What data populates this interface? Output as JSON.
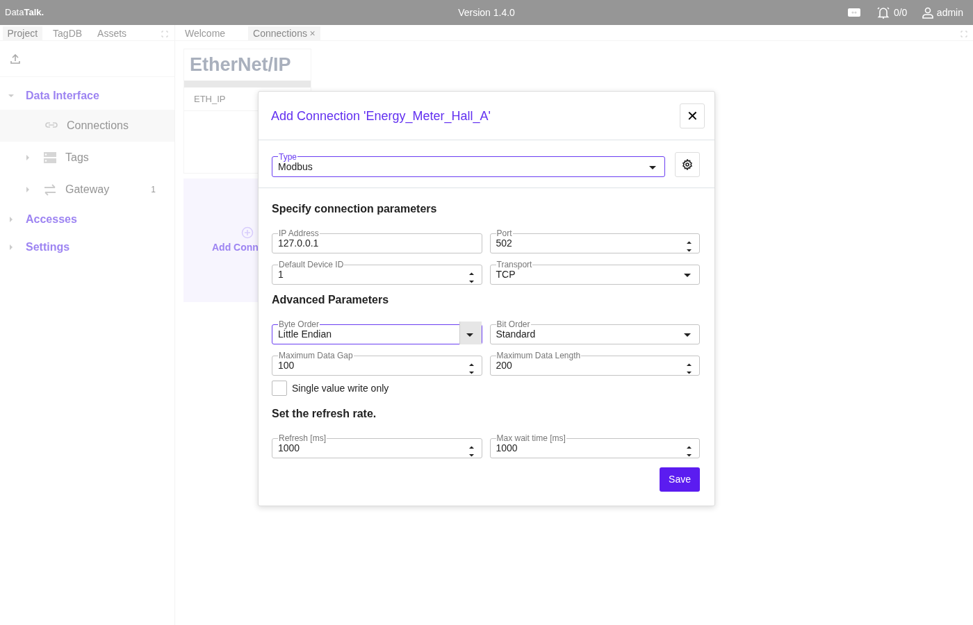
{
  "app": {
    "logo_light": "Data",
    "logo_bold": "Talk.",
    "version": "Version 1.4.0",
    "alarms": "0/0",
    "user": "admin"
  },
  "left_tabs": [
    {
      "label": "Project",
      "selected": true
    },
    {
      "label": "TagDB",
      "selected": false
    },
    {
      "label": "Assets",
      "selected": false
    }
  ],
  "tree": [
    {
      "label": "Data Interface",
      "expanded": true,
      "children": [
        {
          "label": "Connections",
          "selected": true,
          "expandable": false
        },
        {
          "label": "Tags",
          "selected": false,
          "expandable": true
        },
        {
          "label": "Gateway",
          "selected": false,
          "expandable": true,
          "count": "1"
        }
      ]
    },
    {
      "label": "Accesses",
      "expanded": false
    },
    {
      "label": "Settings",
      "expanded": false
    }
  ],
  "doc_tabs": [
    {
      "label": "Welcome",
      "selected": false,
      "closable": false
    },
    {
      "label": "Connections",
      "selected": true,
      "closable": true,
      "close": "×"
    }
  ],
  "connections": [
    {
      "logo": "EtherNet/IP",
      "name": "ETH_IP"
    }
  ],
  "add_card": {
    "label": "Add Conn"
  },
  "dialog": {
    "title": "Add Connection 'Energy_Meter_Hall_A'",
    "close": "✕",
    "type_field": {
      "label": "Type",
      "value": "Modbus",
      "kind": "select",
      "focused": true
    },
    "sections": [
      {
        "heading": "Specify connection parameters",
        "rows": [
          [
            {
              "label": "IP Address",
              "value": "127.0.0.1",
              "kind": "text",
              "focused": false
            },
            {
              "label": "Port",
              "value": "502",
              "kind": "number",
              "focused": false
            }
          ],
          [
            {
              "label": "Default Device ID",
              "value": "1",
              "kind": "number",
              "focused": false
            },
            {
              "label": "Transport",
              "value": "TCP",
              "kind": "select",
              "focused": false
            }
          ]
        ]
      },
      {
        "heading": "Advanced Parameters",
        "rows": [
          [
            {
              "label": "Byte Order",
              "value": "Little Endian",
              "kind": "select",
              "focused": true
            },
            {
              "label": "Bit Order",
              "value": "Standard",
              "kind": "select",
              "focused": false
            }
          ],
          [
            {
              "label": "Maximum Data Gap",
              "value": "100",
              "kind": "number",
              "focused": false
            },
            {
              "label": "Maximum Data Length",
              "value": "200",
              "kind": "number",
              "focused": false
            }
          ]
        ],
        "checkbox": {
          "label": "Single value write only",
          "checked": false
        }
      },
      {
        "heading": "Set the refresh rate.",
        "rows": [
          [
            {
              "label": "Refresh [ms]",
              "value": "1000",
              "kind": "number",
              "focused": false
            },
            {
              "label": "Max wait time [ms]",
              "value": "1000",
              "kind": "number",
              "focused": false
            }
          ]
        ]
      }
    ],
    "save": "Save"
  }
}
